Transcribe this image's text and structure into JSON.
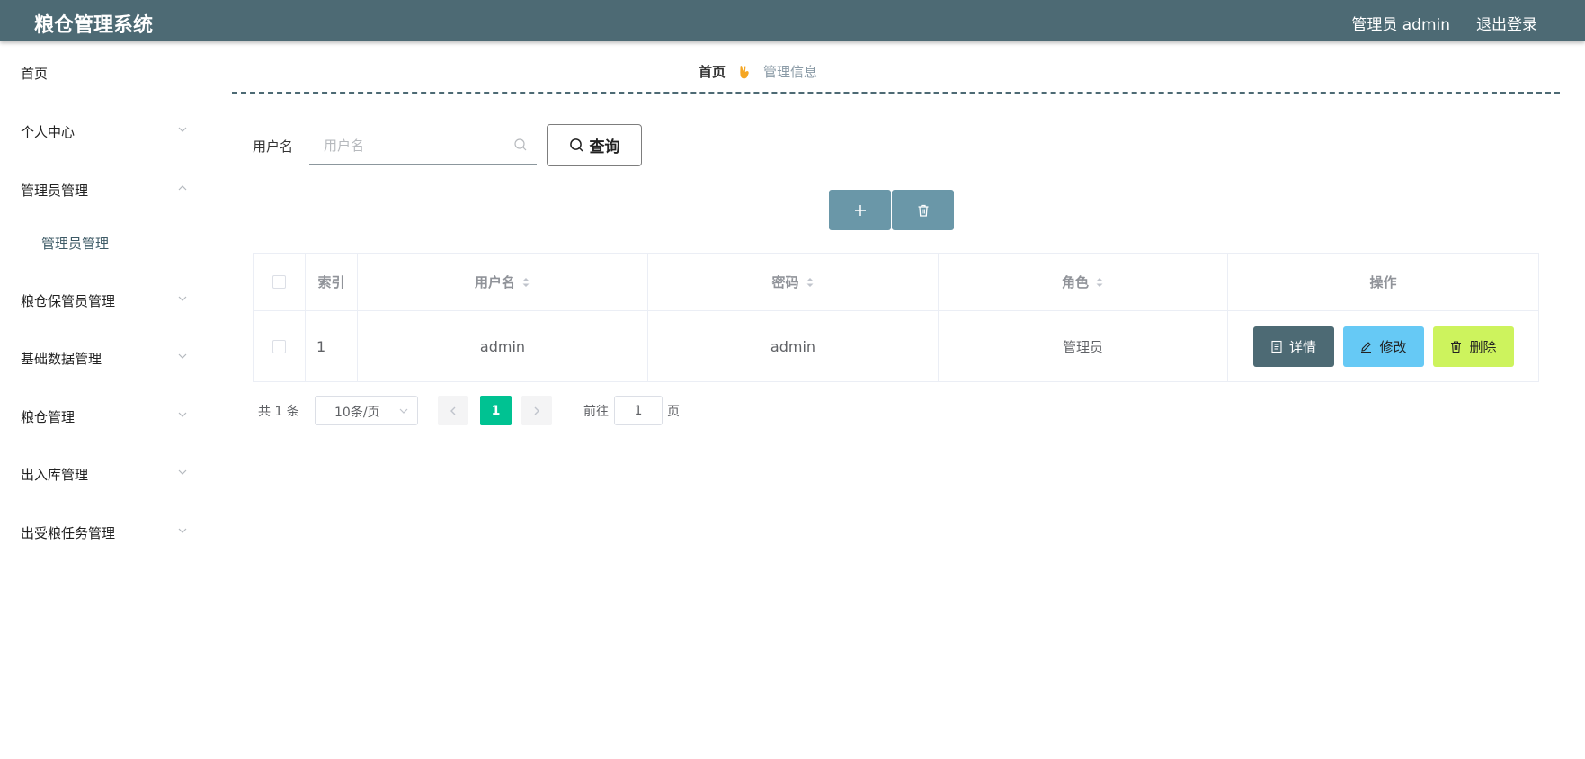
{
  "header": {
    "app_title": "粮仓管理系统",
    "user_label": "管理员 admin",
    "logout_label": "退出登录",
    "bg_color": "#4d6a74"
  },
  "sidebar": {
    "items": [
      {
        "label": "首页",
        "has_chevron": false
      },
      {
        "label": "个人中心",
        "has_chevron": true,
        "expanded": false
      },
      {
        "label": "管理员管理",
        "has_chevron": true,
        "expanded": true
      },
      {
        "label": "粮仓保管员管理",
        "has_chevron": true,
        "expanded": false
      },
      {
        "label": "基础数据管理",
        "has_chevron": true,
        "expanded": false
      },
      {
        "label": "粮仓管理",
        "has_chevron": true,
        "expanded": false
      },
      {
        "label": "出入库管理",
        "has_chevron": true,
        "expanded": false
      },
      {
        "label": "出受粮任务管理",
        "has_chevron": true,
        "expanded": false
      }
    ],
    "submenu": {
      "label": "管理员管理"
    }
  },
  "breadcrumb": {
    "home": "首页",
    "current": "管理信息",
    "separator_icon": "hand-peace-icon"
  },
  "search": {
    "label": "用户名",
    "placeholder": "用户名",
    "value": "",
    "query_label": "查询"
  },
  "toolbar": {
    "add_icon": "plus-icon",
    "delete_icon": "trash-icon",
    "color": "#6a97a8"
  },
  "table": {
    "columns": [
      "索引",
      "用户名",
      "密码",
      "角色",
      "操作"
    ],
    "sortable": [
      "用户名",
      "密码",
      "角色"
    ],
    "rows": [
      {
        "index": "1",
        "username": "admin",
        "password": "admin",
        "role": "管理员"
      }
    ],
    "actions": {
      "detail": "详情",
      "edit": "修改",
      "delete": "删除"
    },
    "action_colors": {
      "detail": "#4d6a74",
      "edit": "#66c9f5",
      "delete": "#cdf35d"
    }
  },
  "pagination": {
    "total_text": "共 1 条",
    "page_size": "10条/页",
    "current_page": "1",
    "goto_label": "前往",
    "goto_value": "1",
    "page_unit": "页",
    "accent": "#00c292"
  }
}
